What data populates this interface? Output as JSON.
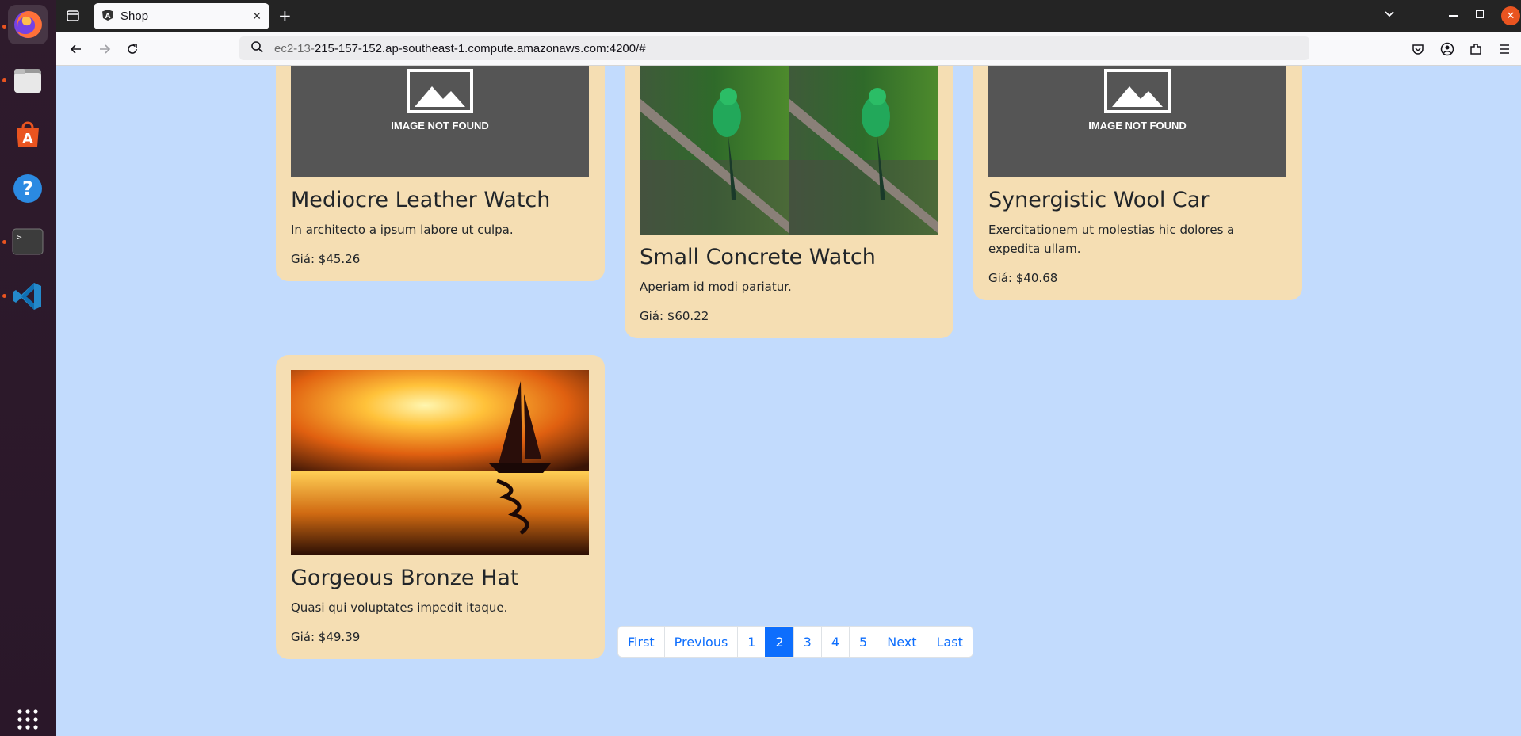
{
  "browser": {
    "tab_title": "Shop",
    "url_dim": "ec2-13-",
    "url_main": "215-157-152.ap-southeast-1.compute.amazonaws.com:4200/#"
  },
  "dock": {
    "apps": [
      "firefox-icon",
      "files-icon",
      "app-center-icon",
      "help-icon",
      "terminal-icon",
      "vscode-icon",
      "app-grid-icon"
    ]
  },
  "products": [
    {
      "title": "Mediocre Leather Watch",
      "desc": "In architecto a ipsum labore ut culpa.",
      "price": "Giá: $45.26",
      "image": "image-not-found",
      "image_text": "IMAGE NOT FOUND"
    },
    {
      "title": "Small Concrete Watch",
      "desc": "Aperiam id modi pariatur.",
      "price": "Giá: $60.22",
      "image": "green-birds-photo"
    },
    {
      "title": "Synergistic Wool Car",
      "desc": "Exercitationem ut molestias hic dolores a expedita ullam.",
      "price": "Giá: $40.68",
      "image": "image-not-found",
      "image_text": "IMAGE NOT FOUND"
    },
    {
      "title": "Gorgeous Bronze Hat",
      "desc": "Quasi qui voluptates impedit itaque.",
      "price": "Giá: $49.39",
      "image": "sailboat-sunset-photo"
    }
  ],
  "pagination": {
    "first": "First",
    "previous": "Previous",
    "pages": [
      "1",
      "2",
      "3",
      "4",
      "5"
    ],
    "active_page": "2",
    "next": "Next",
    "last": "Last"
  },
  "colors": {
    "page_bg": "#c2dbfd",
    "card_bg": "#f5deb3",
    "link": "#0d6efd"
  }
}
